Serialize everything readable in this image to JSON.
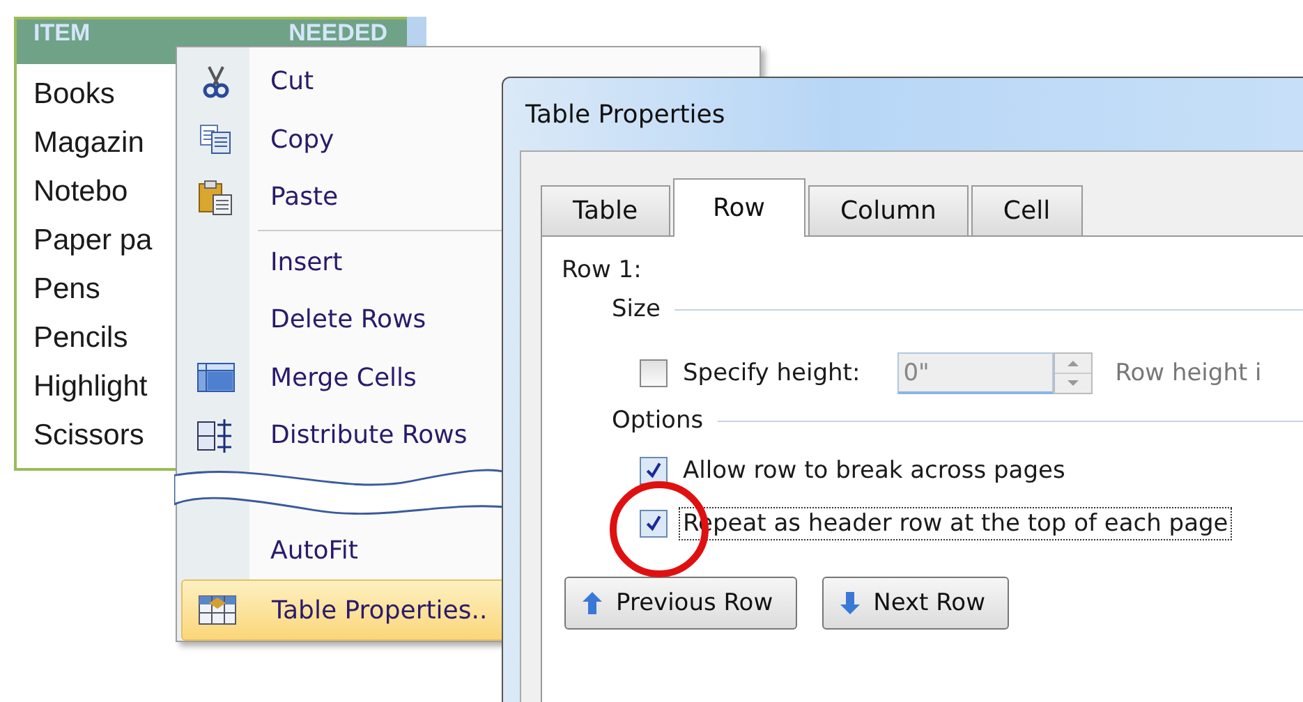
{
  "document_table": {
    "columns": [
      "ITEM",
      "NEEDED"
    ],
    "rows": [
      "Books",
      "Magazin",
      "Notebo",
      "Paper pa",
      "Pens",
      "Pencils",
      "Highlight",
      "Scissors"
    ]
  },
  "context_menu": {
    "items": [
      {
        "kind": "item",
        "label": "Cut",
        "highlighted": false
      },
      {
        "kind": "item",
        "label": "Copy",
        "highlighted": false
      },
      {
        "kind": "item",
        "label": "Paste",
        "highlighted": false
      },
      {
        "kind": "separator"
      },
      {
        "kind": "item",
        "label": "Insert",
        "highlighted": false
      },
      {
        "kind": "item",
        "label": "Delete Rows",
        "highlighted": false
      },
      {
        "kind": "item",
        "label": "Merge Cells",
        "highlighted": false
      },
      {
        "kind": "item",
        "label": "Distribute Rows",
        "highlighted": false
      },
      {
        "kind": "torn"
      },
      {
        "kind": "item",
        "label": "AutoFit",
        "highlighted": false
      },
      {
        "kind": "item",
        "label": "Table Properties..",
        "highlighted": true
      }
    ]
  },
  "dialog": {
    "title": "Table Properties",
    "tabs": [
      {
        "label": "Table",
        "selected": false
      },
      {
        "label": "Row",
        "selected": true
      },
      {
        "label": "Column",
        "selected": false
      },
      {
        "label": "Cell",
        "selected": false
      }
    ],
    "row_heading": "Row 1:",
    "size": {
      "heading": "Size",
      "specify_height": {
        "label": "Specify height:",
        "checked": false
      },
      "height_field": {
        "value": "0\"",
        "disabled": true
      },
      "row_height_label": "Row height i"
    },
    "options": {
      "heading": "Options",
      "items": [
        {
          "label": "Allow row to break across pages",
          "checked": true,
          "focused": false,
          "circled": false
        },
        {
          "label": "Repeat as header row at the top of each page",
          "checked": true,
          "focused": true,
          "circled": true
        }
      ]
    },
    "buttons": [
      {
        "label": "Previous Row",
        "kind": "previous"
      },
      {
        "label": "Next Row",
        "kind": "next"
      }
    ]
  }
}
